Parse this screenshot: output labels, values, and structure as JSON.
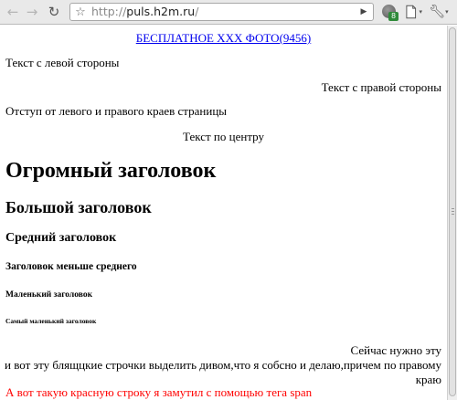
{
  "browser": {
    "url_prefix": "http://",
    "url_host": "puls.h2m.ru",
    "url_suffix": "/",
    "extension_badge": "8",
    "icons": {
      "back": "arrow-left",
      "forward": "arrow-right",
      "reload": "reload",
      "star": "star",
      "go": "play-triangle",
      "extension": "globe",
      "page_menu": "page",
      "wrench_menu": "wrench"
    }
  },
  "page": {
    "banner_link": "БЕСПЛАТНОЕ XXX ФОТО(9456)",
    "left_text": "Текст с левой стороны",
    "right_text": "Текст с правой стороны",
    "indent_text": "Отступ от левого и правого краев страницы",
    "center_text": "Текст по центру",
    "h1": "Огромный заголовок",
    "h2": "Большой заголовок",
    "h3": "Средний заголовок",
    "h4": "Заголовок меньше среднего",
    "h5": "Маленький заголовок",
    "h6": "Самый маленький заголовок",
    "div_line1": "Сейчас нужно эту",
    "div_line2": "и вот эту блящцкие строчки выделить дивом,что я собсно и делаю,причем по правому",
    "div_line3": "краю",
    "red_span": "А вот такую красную строку я замутил с помощью тега span",
    "colors": {
      "link": "#0000ee",
      "red": "#ff0000"
    }
  }
}
